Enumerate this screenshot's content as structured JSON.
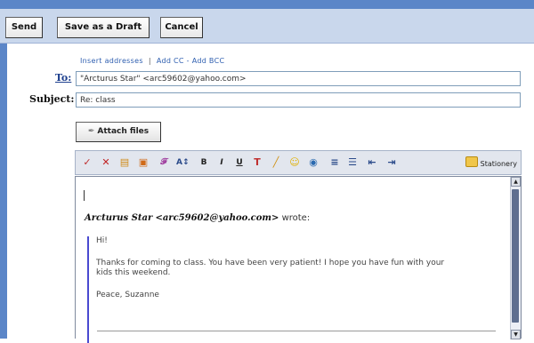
{
  "toolbar": {
    "send_label": "Send",
    "save_draft_label": "Save as a Draft",
    "cancel_label": "Cancel"
  },
  "links": {
    "insert_addresses": "Insert addresses",
    "separator": "|",
    "add_cc_bcc": "Add CC - Add BCC"
  },
  "fields": {
    "to_label": "To:",
    "to_value": "\"Arcturus Star\" <arc59602@yahoo.com>",
    "subject_label": "Subject:",
    "subject_value": "Re: class"
  },
  "attach": {
    "label": "Attach files"
  },
  "format_toolbar": {
    "icons": [
      "spellcheck-icon",
      "cut-icon",
      "copy-icon",
      "paste-icon",
      "font-icon",
      "font-size-icon",
      "bold-icon",
      "italic-icon",
      "underline-icon",
      "text-color-icon",
      "highlight-icon",
      "emoticon-icon",
      "link-icon",
      "align-icon",
      "bullet-list-icon",
      "outdent-icon",
      "indent-icon",
      "stationery-icon"
    ],
    "stationery_label": "Stationery"
  },
  "message": {
    "sender_name": "Arcturus Star",
    "sender_email": "<arc59602@yahoo.com>",
    "wrote": "wrote:",
    "greeting": "Hi!",
    "body_line1": "Thanks for coming to class.  You have been very patient! I hope you have fun with your",
    "body_line2": "kids this weekend.",
    "signature": "Peace, Suzanne"
  },
  "colors": {
    "chrome_blue": "#5b86c8",
    "toolbar_bg": "#c9d7ec",
    "link_blue": "#2f5fb0",
    "quote_bar": "#4a4ad0"
  }
}
